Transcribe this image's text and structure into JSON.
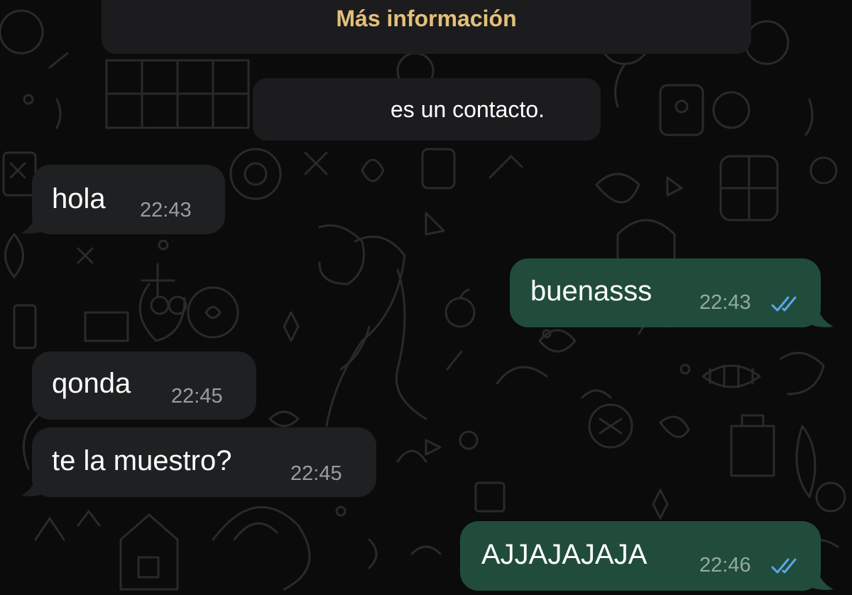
{
  "info_banner": {
    "link_text": "Más información"
  },
  "contact_notice": {
    "text": "es un contacto."
  },
  "messages": [
    {
      "direction": "incoming",
      "text": "hola",
      "time": "22:43"
    },
    {
      "direction": "outgoing",
      "text": "buenasss",
      "time": "22:43",
      "status": "read"
    },
    {
      "direction": "incoming",
      "text": "qonda",
      "time": "22:45"
    },
    {
      "direction": "incoming",
      "text": "te la muestro?",
      "time": "22:45"
    },
    {
      "direction": "outgoing",
      "text": "AJJAJAJAJA",
      "time": "22:46",
      "status": "read"
    }
  ],
  "colors": {
    "background": "#0b0b0b",
    "incoming_bubble": "#1f2022",
    "outgoing_bubble": "#214c3b",
    "info_link": "#e3c07a",
    "read_ticks": "#5aa7e8"
  },
  "icons": [
    "double-check-read-icon",
    "bubble-tail-icon"
  ]
}
